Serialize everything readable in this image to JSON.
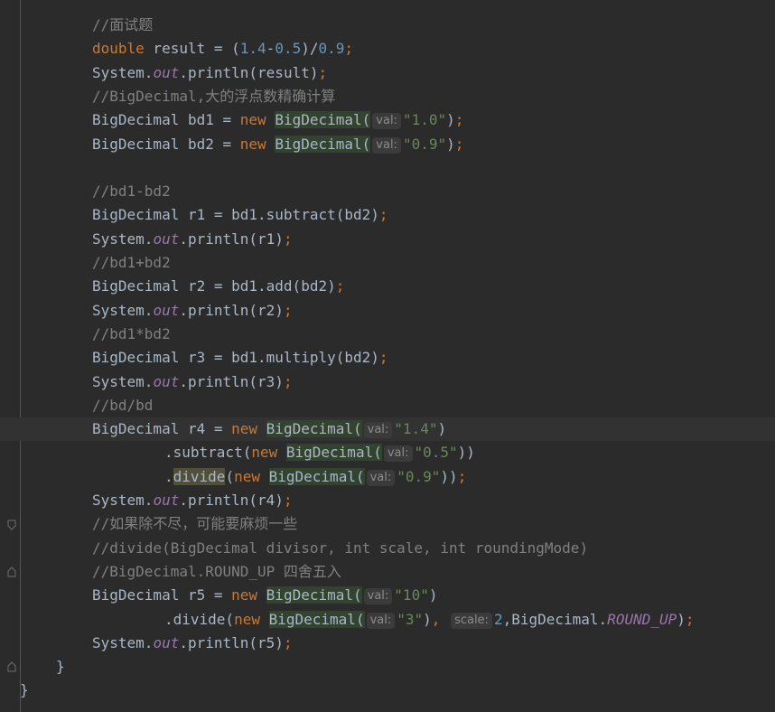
{
  "colors": {
    "background": "#2b2b2b",
    "keyword": "#cc7832",
    "number": "#6897bb",
    "string": "#6a8759",
    "comment": "#808080",
    "static_field": "#9876aa",
    "default_text": "#a9b7c6",
    "inlay_hint_bg": "#3b3b3b"
  },
  "lines": [
    {
      "id": "l1",
      "segments": [
        {
          "t": "//面试题",
          "c": "cmt"
        }
      ]
    },
    {
      "id": "l2",
      "segments": [
        {
          "t": "double",
          "c": "kw"
        },
        {
          "t": " result = ("
        },
        {
          "t": "1.4",
          "c": "num"
        },
        {
          "t": "-"
        },
        {
          "t": "0.5",
          "c": "num"
        },
        {
          "t": ")/"
        },
        {
          "t": "0.9",
          "c": "num"
        },
        {
          "t": ";",
          "c": "kw"
        }
      ]
    },
    {
      "id": "l3",
      "segments": [
        {
          "t": "System."
        },
        {
          "t": "out",
          "c": "field"
        },
        {
          "t": ".println(result)"
        },
        {
          "t": ";",
          "c": "kw"
        }
      ]
    },
    {
      "id": "l4",
      "segments": [
        {
          "t": "//BigDecimal,大的浮点数精确计算",
          "c": "cmt"
        }
      ]
    },
    {
      "id": "l5",
      "segments": [
        {
          "t": "BigDecimal bd1 = "
        },
        {
          "t": "new",
          "c": "kw"
        },
        {
          "t": " "
        },
        {
          "t": "BigDecimal(",
          "c": "cls-hl"
        },
        {
          "hint": "val:"
        },
        {
          "t": "\"1.0\"",
          "c": "str"
        },
        {
          "t": ")"
        },
        {
          "t": ";",
          "c": "kw"
        }
      ]
    },
    {
      "id": "l6",
      "segments": [
        {
          "t": "BigDecimal bd2 = "
        },
        {
          "t": "new",
          "c": "kw"
        },
        {
          "t": " "
        },
        {
          "t": "BigDecimal(",
          "c": "cls-hl"
        },
        {
          "hint": "val:"
        },
        {
          "t": "\"0.9\"",
          "c": "str"
        },
        {
          "t": ")"
        },
        {
          "t": ";",
          "c": "kw"
        }
      ]
    },
    {
      "id": "l7",
      "segments": []
    },
    {
      "id": "l8",
      "segments": [
        {
          "t": "//bd1-bd2",
          "c": "cmt"
        }
      ]
    },
    {
      "id": "l9",
      "segments": [
        {
          "t": "BigDecimal r1 = bd1.subtract(bd2)"
        },
        {
          "t": ";",
          "c": "kw"
        }
      ]
    },
    {
      "id": "l10",
      "segments": [
        {
          "t": "System."
        },
        {
          "t": "out",
          "c": "field"
        },
        {
          "t": ".println(r1)"
        },
        {
          "t": ";",
          "c": "kw"
        }
      ]
    },
    {
      "id": "l11",
      "segments": [
        {
          "t": "//bd1+bd2",
          "c": "cmt"
        }
      ]
    },
    {
      "id": "l12",
      "segments": [
        {
          "t": "BigDecimal r2 = bd1.add(bd2)"
        },
        {
          "t": ";",
          "c": "kw"
        }
      ]
    },
    {
      "id": "l13",
      "segments": [
        {
          "t": "System."
        },
        {
          "t": "out",
          "c": "field"
        },
        {
          "t": ".println(r2)"
        },
        {
          "t": ";",
          "c": "kw"
        }
      ]
    },
    {
      "id": "l14",
      "segments": [
        {
          "t": "//bd1*bd2",
          "c": "cmt"
        }
      ]
    },
    {
      "id": "l15",
      "segments": [
        {
          "t": "BigDecimal r3 = bd1.multiply(bd2)"
        },
        {
          "t": ";",
          "c": "kw"
        }
      ]
    },
    {
      "id": "l16",
      "segments": [
        {
          "t": "System."
        },
        {
          "t": "out",
          "c": "field"
        },
        {
          "t": ".println(r3)"
        },
        {
          "t": ";",
          "c": "kw"
        }
      ]
    },
    {
      "id": "l17",
      "segments": [
        {
          "t": "//bd/bd",
          "c": "cmt"
        }
      ]
    },
    {
      "id": "l18",
      "current": true,
      "segments": [
        {
          "t": "BigDecimal r4 = "
        },
        {
          "t": "new",
          "c": "kw"
        },
        {
          "t": " "
        },
        {
          "t": "BigDecimal(",
          "c": "cls-hl"
        },
        {
          "hint": "val:"
        },
        {
          "t": "\"1.4\"",
          "c": "str"
        },
        {
          "t": ")"
        }
      ]
    },
    {
      "id": "l19",
      "indent": 2,
      "segments": [
        {
          "t": ".subtract("
        },
        {
          "t": "new",
          "c": "kw"
        },
        {
          "t": " "
        },
        {
          "t": "BigDecimal(",
          "c": "cls-hl"
        },
        {
          "hint": "val:"
        },
        {
          "t": "\"0.5\"",
          "c": "str"
        },
        {
          "t": "))"
        }
      ]
    },
    {
      "id": "l20",
      "indent": 2,
      "segments": [
        {
          "t": "."
        },
        {
          "t": "divide",
          "c": "warn-hl"
        },
        {
          "t": "("
        },
        {
          "t": "new",
          "c": "kw"
        },
        {
          "t": " "
        },
        {
          "t": "BigDecimal(",
          "c": "cls-hl"
        },
        {
          "hint": "val:"
        },
        {
          "t": "\"0.9\"",
          "c": "str"
        },
        {
          "t": "))"
        },
        {
          "t": ";",
          "c": "kw"
        }
      ]
    },
    {
      "id": "l21",
      "segments": [
        {
          "t": "System."
        },
        {
          "t": "out",
          "c": "field"
        },
        {
          "t": ".println(r4)"
        },
        {
          "t": ";",
          "c": "kw"
        }
      ]
    },
    {
      "id": "l22",
      "segments": [
        {
          "t": "//如果除不尽，可能要麻烦一些",
          "c": "cmt"
        }
      ]
    },
    {
      "id": "l23",
      "segments": [
        {
          "t": "//divide(BigDecimal divisor, int scale, int roundingMode)",
          "c": "cmt"
        }
      ]
    },
    {
      "id": "l24",
      "segments": [
        {
          "t": "//BigDecimal.ROUND_UP 四舍五入",
          "c": "cmt"
        }
      ]
    },
    {
      "id": "l25",
      "segments": [
        {
          "t": "BigDecimal r5 = "
        },
        {
          "t": "new",
          "c": "kw"
        },
        {
          "t": " "
        },
        {
          "t": "BigDecimal(",
          "c": "cls-hl"
        },
        {
          "hint": "val:"
        },
        {
          "t": "\"10\"",
          "c": "str"
        },
        {
          "t": ")"
        }
      ]
    },
    {
      "id": "l26",
      "indent": 2,
      "segments": [
        {
          "t": ".divide("
        },
        {
          "t": "new",
          "c": "kw"
        },
        {
          "t": " "
        },
        {
          "t": "BigDecimal(",
          "c": "cls-hl"
        },
        {
          "hint": "val:"
        },
        {
          "t": "\"3\"",
          "c": "str"
        },
        {
          "t": ")"
        },
        {
          "t": ",",
          "c": "kw"
        },
        {
          "t": " "
        },
        {
          "hint": "scale:"
        },
        {
          "t": "2",
          "c": "num"
        },
        {
          "t": ",BigDecimal."
        },
        {
          "t": "ROUND_UP",
          "c": "field"
        },
        {
          "t": ")"
        },
        {
          "t": ";",
          "c": "kw"
        }
      ]
    },
    {
      "id": "l27",
      "segments": [
        {
          "t": "System."
        },
        {
          "t": "out",
          "c": "field"
        },
        {
          "t": ".println(r5)"
        },
        {
          "t": ";",
          "c": "kw"
        }
      ]
    },
    {
      "id": "l28",
      "level": "method",
      "segments": [
        {
          "t": "}"
        }
      ]
    },
    {
      "id": "l29",
      "level": "class",
      "segments": [
        {
          "t": "}"
        }
      ]
    }
  ]
}
